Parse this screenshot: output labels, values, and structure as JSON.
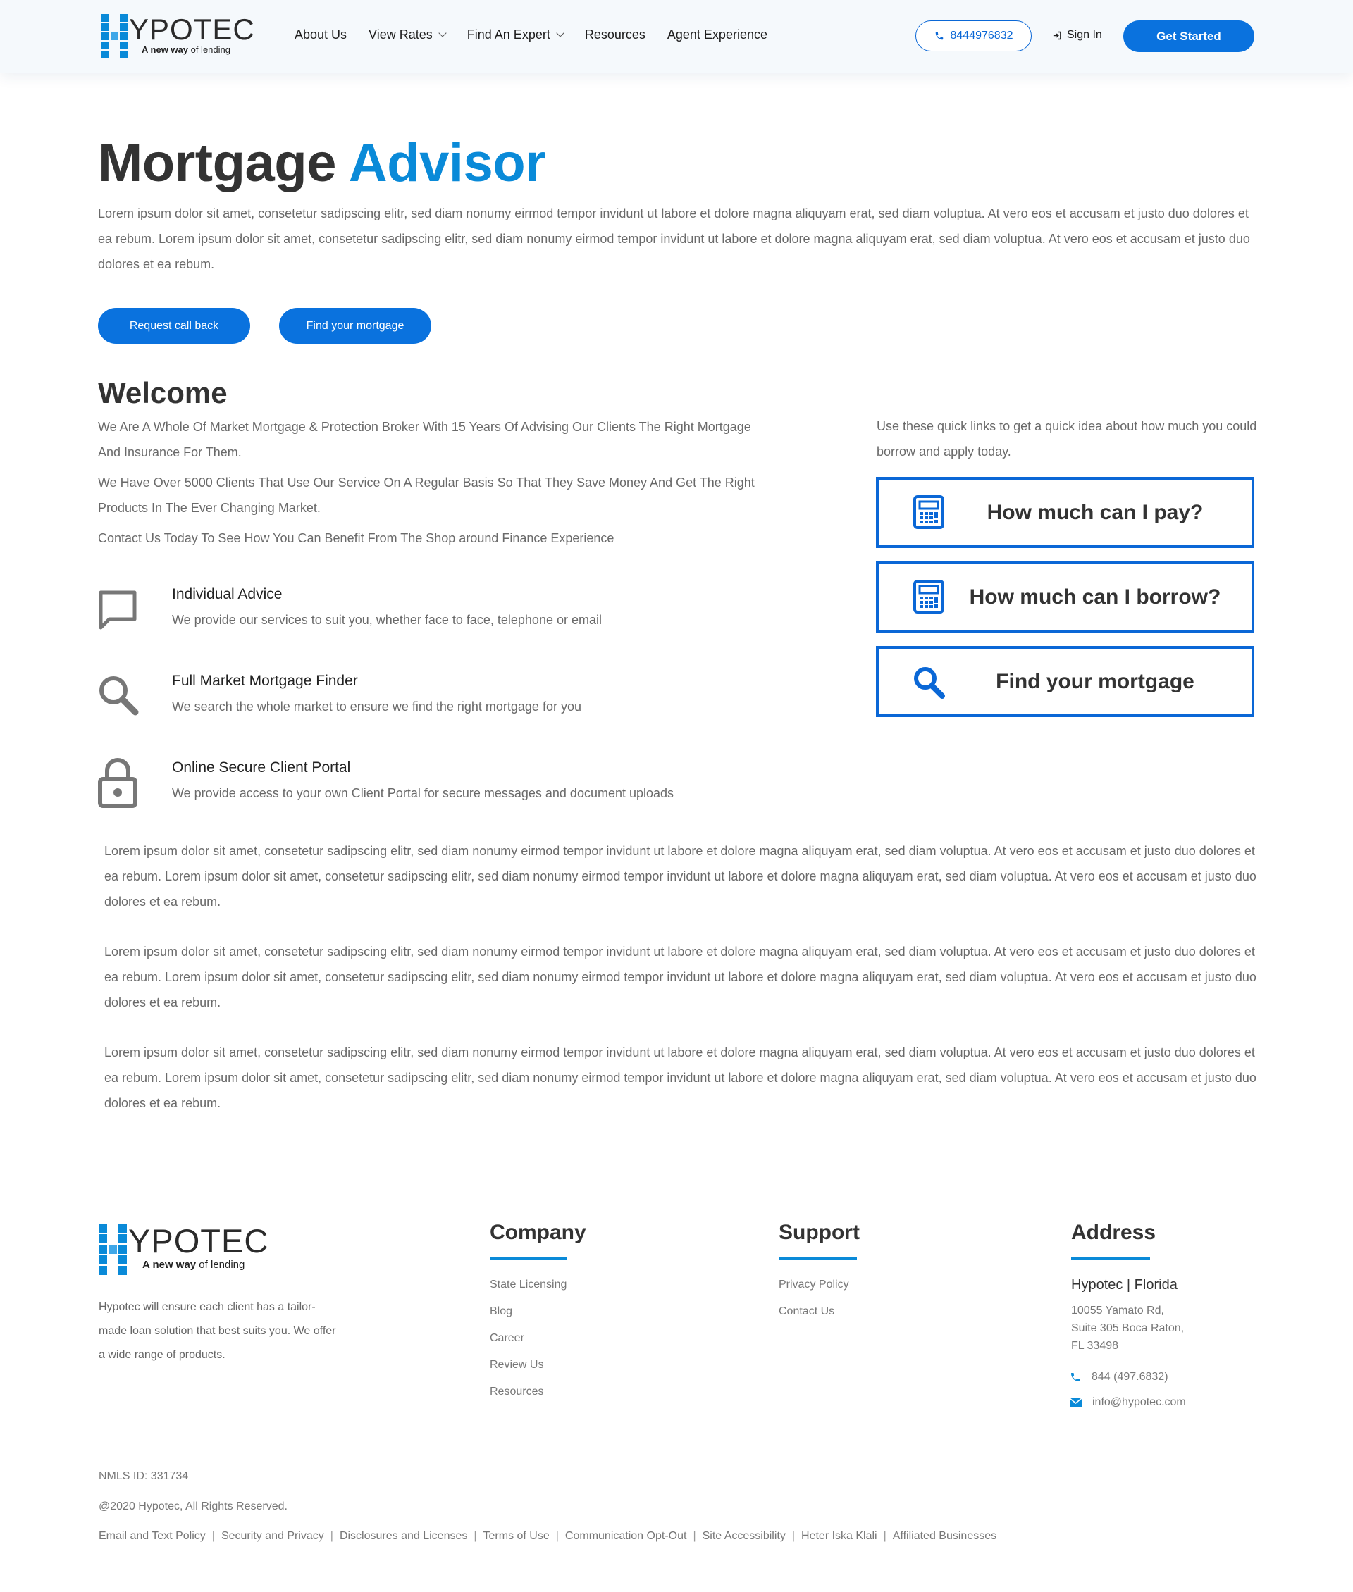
{
  "brand": {
    "logo_text": "YPOTEC",
    "tagline_bold": "A new way",
    "tagline_rest": " of lending",
    "colors": {
      "primary": "#0a72de",
      "accent": "#0a8ad8",
      "dark_text": "#333333",
      "body_text": "#6a6a6a"
    }
  },
  "header": {
    "nav": [
      {
        "label": "About Us",
        "dropdown": false
      },
      {
        "label": "View Rates",
        "dropdown": true
      },
      {
        "label": "Find An Expert",
        "dropdown": true
      },
      {
        "label": "Resources",
        "dropdown": false
      },
      {
        "label": "Agent Experience",
        "dropdown": false
      }
    ],
    "phone": "8444976832",
    "signin": "Sign In",
    "get_started": "Get Started",
    "icons": {
      "phone": "phone-icon",
      "signin": "sign-in-icon",
      "dropdown": "chevron-down-icon"
    }
  },
  "hero": {
    "title_main": "Mortgage ",
    "title_accent": "Advisor",
    "text": "Lorem ipsum dolor sit amet, consetetur sadipscing elitr, sed diam nonumy eirmod tempor invidunt ut labore et dolore magna aliquyam erat, sed diam voluptua. At vero eos et accusam et justo duo dolores et ea rebum.  Lorem ipsum dolor sit amet, consetetur sadipscing elitr, sed diam nonumy eirmod tempor invidunt ut labore et dolore magna aliquyam erat, sed diam voluptua. At vero eos et accusam et justo duo dolores et ea rebum.",
    "buttons": [
      "Request call back",
      "Find your mortgage"
    ]
  },
  "welcome": {
    "title": "Welcome",
    "paragraphs": [
      "We Are A Whole Of Market Mortgage & Protection Broker With 15 Years Of Advising Our Clients The Right Mortgage And Insurance For Them.",
      "We Have Over 5000 Clients That Use Our Service On A Regular Basis So That They Save Money And Get The Right Products In The Ever Changing Market.",
      "Contact Us Today To See How You Can Benefit From The Shop around Finance Experience"
    ],
    "features": [
      {
        "title": "Individual Advice",
        "desc": "We provide our services to suit you, whether face to face, telephone or email",
        "icon": "chat-bubble-icon"
      },
      {
        "title": "Full Market Mortgage Finder",
        "desc": "We search the whole market to ensure we find the right mortgage for you",
        "icon": "search-icon"
      },
      {
        "title": "Online Secure Client Portal",
        "desc": "We provide access to your own Client Portal for secure messages and document uploads",
        "icon": "lock-icon"
      }
    ]
  },
  "quick_links": {
    "intro": "Use these quick links to get a quick idea about how much you could borrow and apply today.",
    "items": [
      {
        "label": "How much can I pay?",
        "icon": "calculator-icon"
      },
      {
        "label": "How much can I borrow?",
        "icon": "calculator-icon"
      },
      {
        "label": "Find your mortgage",
        "icon": "search-icon"
      }
    ]
  },
  "body_paragraphs": [
    "Lorem ipsum dolor sit amet, consetetur sadipscing elitr, sed diam nonumy eirmod tempor invidunt ut labore et dolore magna aliquyam erat, sed diam voluptua. At vero eos et accusam et justo duo dolores et ea rebum.  Lorem ipsum dolor sit amet, consetetur sadipscing elitr, sed diam nonumy eirmod tempor invidunt ut labore et dolore magna aliquyam erat, sed diam voluptua. At vero eos et accusam et justo duo dolores et ea rebum.",
    "Lorem ipsum dolor sit amet, consetetur sadipscing elitr, sed diam nonumy eirmod tempor invidunt ut labore et dolore magna aliquyam erat, sed diam voluptua. At vero eos et accusam et justo duo dolores et ea rebum.  Lorem ipsum dolor sit amet, consetetur sadipscing elitr, sed diam nonumy eirmod tempor invidunt ut labore et dolore magna aliquyam erat, sed diam voluptua. At vero eos et accusam et justo duo dolores et ea rebum.",
    "Lorem ipsum dolor sit amet, consetetur sadipscing elitr, sed diam nonumy eirmod tempor invidunt ut labore et dolore magna aliquyam erat, sed diam voluptua. At vero eos et accusam et justo duo dolores et ea rebum.  Lorem ipsum dolor sit amet, consetetur sadipscing elitr, sed diam nonumy eirmod tempor invidunt ut labore et dolore magna aliquyam erat, sed diam voluptua. At vero eos et accusam et justo duo dolores et ea rebum."
  ],
  "footer": {
    "description": "Hypotec will ensure each client has a tailor-made loan solution that best suits you. We offer a wide range of products.",
    "company": {
      "title": "Company",
      "links": [
        "State Licensing",
        "Blog",
        "Career",
        "Review Us",
        "Resources"
      ]
    },
    "support": {
      "title": "Support",
      "links": [
        "Privacy Policy",
        "Contact Us"
      ]
    },
    "address": {
      "title": "Address",
      "name": "Hypotec | Florida",
      "lines": [
        "10055 Yamato Rd,",
        "Suite 305 Boca Raton,",
        "FL 33498"
      ],
      "phone": "844 (497.6832)",
      "email": "info@hypotec.com"
    },
    "nmls": "NMLS ID: 331734",
    "copyright": "@2020 Hypotec, All Rights Reserved.",
    "legal_links": [
      "Email and Text Policy",
      "Security and Privacy",
      "Disclosures and Licenses",
      "Terms of Use",
      "Communication Opt-Out",
      "Site Accessibility",
      "Heter Iska Klali",
      "Affiliated Businesses"
    ]
  }
}
